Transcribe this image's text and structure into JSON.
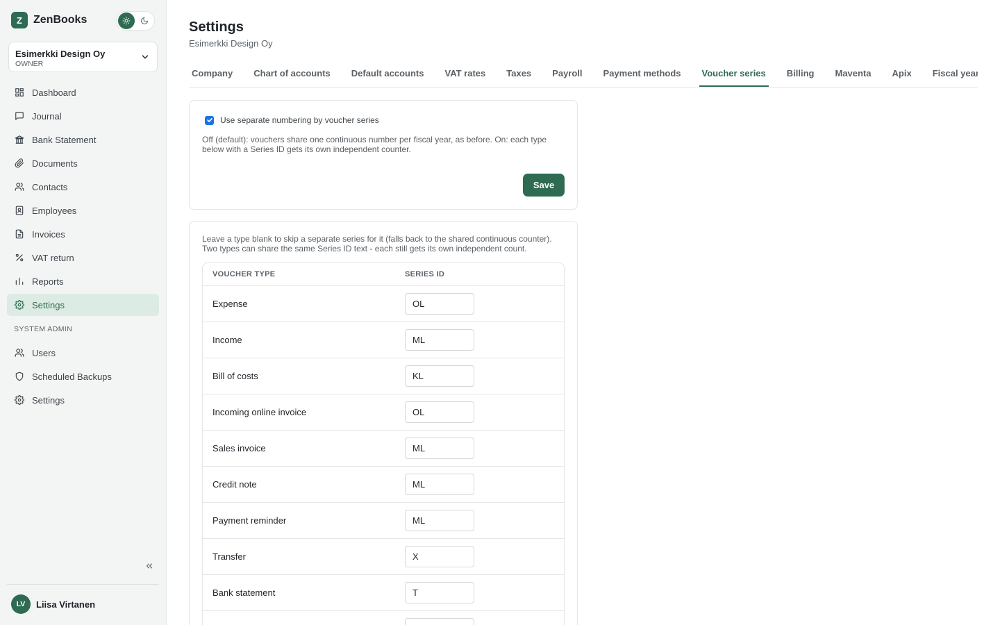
{
  "brand": {
    "logo_letter": "Z",
    "name": "ZenBooks"
  },
  "theme": {
    "light_icon": "sun-icon",
    "dark_icon": "moon-icon",
    "active": "light"
  },
  "company": {
    "name": "Esimerkki Design Oy",
    "role": "OWNER"
  },
  "sidebar": {
    "items": [
      {
        "label": "Dashboard",
        "icon": "dashboard-icon"
      },
      {
        "label": "Journal",
        "icon": "chat-icon"
      },
      {
        "label": "Bank Statement",
        "icon": "bank-icon"
      },
      {
        "label": "Documents",
        "icon": "paperclip-icon"
      },
      {
        "label": "Contacts",
        "icon": "users-icon"
      },
      {
        "label": "Employees",
        "icon": "id-badge-icon"
      },
      {
        "label": "Invoices",
        "icon": "file-icon"
      },
      {
        "label": "VAT return",
        "icon": "percent-icon"
      },
      {
        "label": "Reports",
        "icon": "bar-chart-icon"
      },
      {
        "label": "Settings",
        "icon": "gear-icon",
        "active": true
      }
    ],
    "admin_section_label": "SYSTEM ADMIN",
    "admin_items": [
      {
        "label": "Users",
        "icon": "users-icon"
      },
      {
        "label": "Scheduled Backups",
        "icon": "shield-icon"
      },
      {
        "label": "Settings",
        "icon": "gear-icon"
      }
    ]
  },
  "user": {
    "initials": "LV",
    "name": "Liisa Virtanen"
  },
  "page": {
    "title": "Settings",
    "subtitle": "Esimerkki Design Oy"
  },
  "tabs": [
    {
      "label": "Company"
    },
    {
      "label": "Chart of accounts"
    },
    {
      "label": "Default accounts"
    },
    {
      "label": "VAT rates"
    },
    {
      "label": "Taxes"
    },
    {
      "label": "Payroll"
    },
    {
      "label": "Payment methods"
    },
    {
      "label": "Voucher series",
      "active": true
    },
    {
      "label": "Billing"
    },
    {
      "label": "Maventa"
    },
    {
      "label": "Apix"
    },
    {
      "label": "Fiscal year"
    }
  ],
  "numbering": {
    "checkbox_label": "Use separate numbering by voucher series",
    "checked": true,
    "help": "Off (default): vouchers share one continuous number per fiscal year, as before. On: each type below with a Series ID gets its own independent counter.",
    "save_label": "Save"
  },
  "series": {
    "help": "Leave a type blank to skip a separate series for it (falls back to the shared continuous counter). Two types can share the same Series ID text - each still gets its own independent count.",
    "columns": [
      "VOUCHER TYPE",
      "SERIES ID"
    ],
    "rows": [
      {
        "type": "Expense",
        "series_id": "OL"
      },
      {
        "type": "Income",
        "series_id": "ML"
      },
      {
        "type": "Bill of costs",
        "series_id": "KL"
      },
      {
        "type": "Incoming online invoice",
        "series_id": "OL"
      },
      {
        "type": "Sales invoice",
        "series_id": "ML"
      },
      {
        "type": "Credit note",
        "series_id": "ML"
      },
      {
        "type": "Payment reminder",
        "series_id": "ML"
      },
      {
        "type": "Transfer",
        "series_id": "X"
      },
      {
        "type": "Bank statement",
        "series_id": "T"
      },
      {
        "type": "",
        "series_id": ""
      }
    ]
  },
  "colors": {
    "accent": "#2e6b52",
    "accent_light": "#dcebe3",
    "sidebar_bg": "#f3f5f5"
  }
}
